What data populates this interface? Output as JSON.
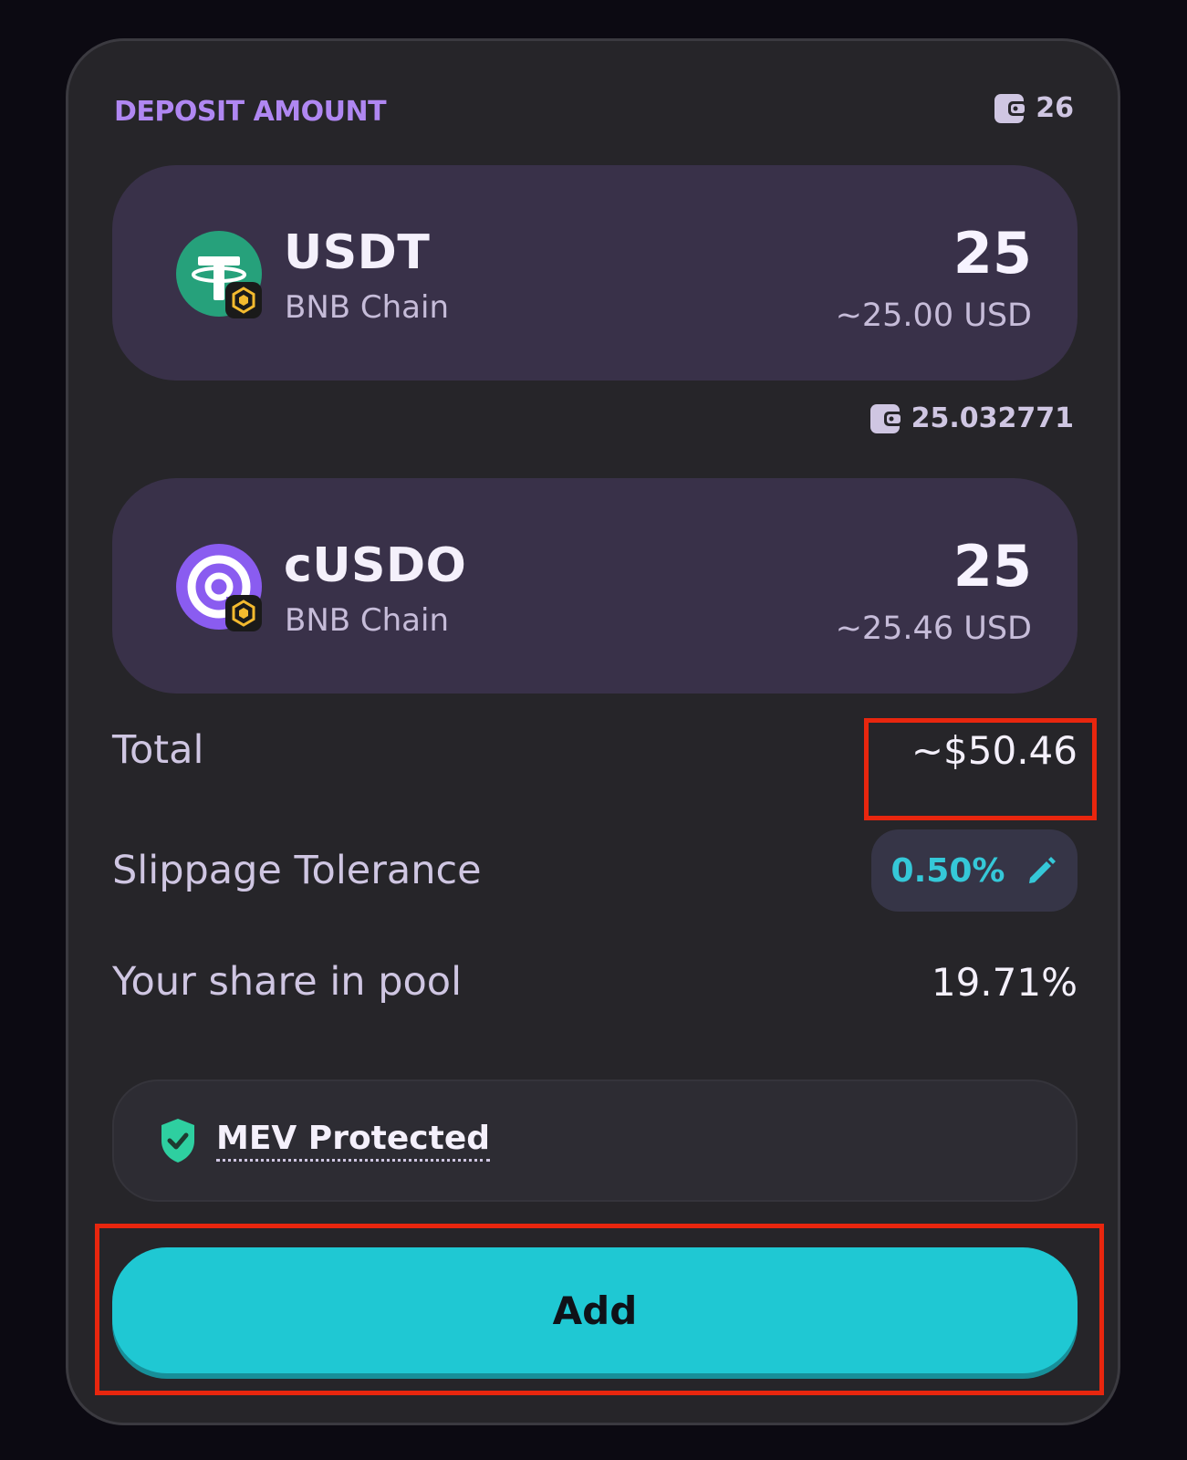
{
  "deposit": {
    "title": "DEPOSIT AMOUNT",
    "wallet_balance": "26"
  },
  "tokens": [
    {
      "symbol": "USDT",
      "chain": "BNB Chain",
      "amount": "25",
      "usd_value": "~25.00 USD",
      "logo_icon": "tether-icon",
      "logo_color": "#26a17b"
    },
    {
      "symbol": "cUSDO",
      "chain": "BNB Chain",
      "amount": "25",
      "usd_value": "~25.46 USD",
      "logo_icon": "cusdo-icon",
      "logo_color": "#8a5cf0"
    }
  ],
  "second_token_balance": "25.032771",
  "summary": {
    "total_label": "Total",
    "total_value": "~$50.46",
    "slippage_label": "Slippage Tolerance",
    "slippage_value": "0.50%",
    "share_label": "Your share in pool",
    "share_value": "19.71%"
  },
  "mev": {
    "label": "MEV Protected",
    "icon": "shield-check-icon"
  },
  "actions": {
    "add_label": "Add"
  },
  "colors": {
    "accent_purple": "#b087f2",
    "accent_cyan": "#1fc8d3",
    "highlight_red": "#e8260e",
    "mev_green": "#2ecfa0"
  }
}
